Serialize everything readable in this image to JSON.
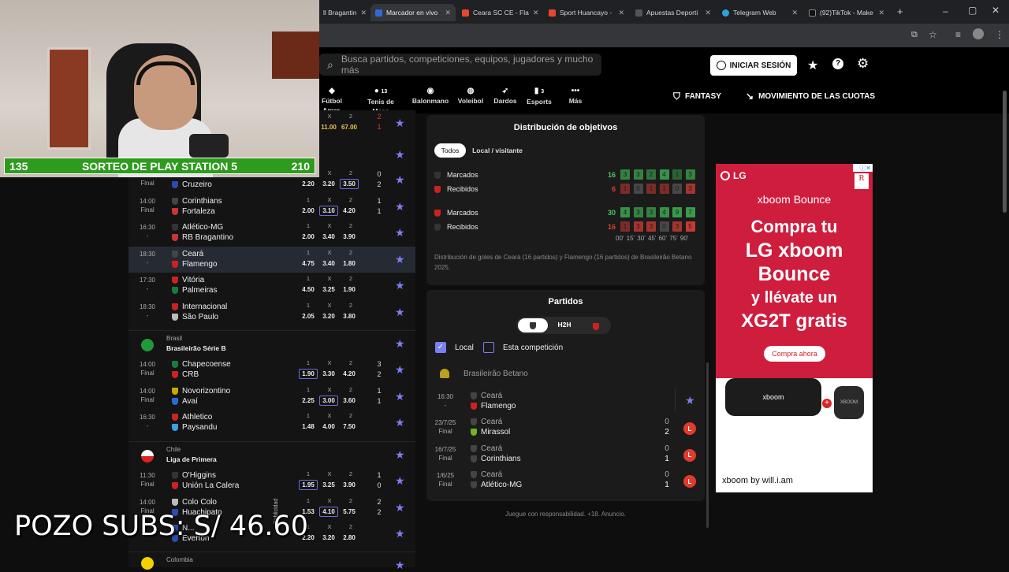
{
  "browser": {
    "tabs": [
      {
        "label": "ll Bragantin",
        "color": "#4a7bd4",
        "active": false
      },
      {
        "label": "Marcador en vivo",
        "color": "#2f6ad8",
        "active": true
      },
      {
        "label": "Ceara SC CE - Fla",
        "color": "#e8472f",
        "active": false
      },
      {
        "label": "Sport Huancayo -",
        "color": "#e8472f",
        "active": false
      },
      {
        "label": "Apuestas Deporti",
        "color": "#222",
        "active": false
      },
      {
        "label": "Telegram Web",
        "color": "#2aa3e0",
        "active": false
      },
      {
        "label": "(92)TikTok - Make",
        "color": "#111",
        "active": false
      }
    ]
  },
  "header": {
    "search_placeholder": "Busca partidos, competiciones, equipos, jugadores y mucho más",
    "login_label": "INICIAR SESIÓN"
  },
  "sports_nav": [
    {
      "label": "Fútbol Amer.",
      "count": ""
    },
    {
      "label": "Tenis de Mesa",
      "count": "13"
    },
    {
      "label": "Balonmano",
      "count": ""
    },
    {
      "label": "Voleibol",
      "count": ""
    },
    {
      "label": "Dardos",
      "count": ""
    },
    {
      "label": "Esports",
      "count": "3"
    },
    {
      "label": "Más",
      "count": ""
    }
  ],
  "top_buttons": {
    "fantasy": "FANTASY",
    "odds_movement": "MOVIMIENTO DE LAS CUOTAS"
  },
  "stream": {
    "sorteo_left": "135",
    "sorteo_title": "SORTEO DE PLAY STATION 5",
    "sorteo_right": "210",
    "pozo": "POZO SUBS: S/ 46.60",
    "publicidad": "Publicidad"
  },
  "odds_headers": {
    "one": "1",
    "x": "X",
    "two": "2"
  },
  "top_partial": {
    "odd_x": "11.00",
    "odd_2": "67.00",
    "s1": "2",
    "s2": "1"
  },
  "matches_a": [
    {
      "time": "",
      "status": "Final",
      "home": "",
      "away": "Cruzeiro",
      "o1": "2.20",
      "ox": "3.20",
      "o2": "3.50",
      "s1": "0",
      "s2": "2",
      "box": "o2",
      "hc": "#555",
      "ac": "#2b4bb0"
    },
    {
      "time": "14:00",
      "status": "Final",
      "home": "Corinthians",
      "away": "Fortaleza",
      "o1": "2.00",
      "ox": "3.10",
      "o2": "4.20",
      "s1": "1",
      "s2": "1",
      "box": "ox",
      "hc": "#444",
      "ac": "#c33"
    },
    {
      "time": "16:30",
      "status": "-",
      "home": "Atlético-MG",
      "away": "RB Bragantino",
      "o1": "2.00",
      "ox": "3.40",
      "o2": "3.90",
      "s1": "",
      "s2": "",
      "box": "",
      "hc": "#333",
      "ac": "#c33"
    },
    {
      "time": "18:30",
      "status": "-",
      "home": "Ceará",
      "away": "Flamengo",
      "o1": "4.75",
      "ox": "3.40",
      "o2": "1.80",
      "s1": "",
      "s2": "",
      "box": "",
      "hc": "#444",
      "ac": "#c22"
    },
    {
      "time": "17:30",
      "status": "-",
      "home": "Vitória",
      "away": "Palmeiras",
      "o1": "4.50",
      "ox": "3.25",
      "o2": "1.90",
      "s1": "",
      "s2": "",
      "box": "",
      "hc": "#c22",
      "ac": "#1a7a3a"
    },
    {
      "time": "18:30",
      "status": "-",
      "home": "Internacional",
      "away": "São Paulo",
      "o1": "2.05",
      "ox": "3.20",
      "o2": "3.80",
      "s1": "",
      "s2": "",
      "box": "",
      "hc": "#c22",
      "ac": "#bbb"
    }
  ],
  "league_b": {
    "country": "Brasil",
    "name": "Brasileirão Série B"
  },
  "matches_b": [
    {
      "time": "14:00",
      "status": "Final",
      "home": "Chapecoense",
      "away": "CRB",
      "o1": "1.90",
      "ox": "3.30",
      "o2": "4.20",
      "s1": "3",
      "s2": "2",
      "box": "o1",
      "hc": "#1a7a3a",
      "ac": "#c22"
    },
    {
      "time": "14:00",
      "status": "Final",
      "home": "Novorizontino",
      "away": "Avaí",
      "o1": "2.25",
      "ox": "3.00",
      "o2": "3.60",
      "s1": "1",
      "s2": "1",
      "box": "ox",
      "hc": "#c9a800",
      "ac": "#2b6bd0"
    },
    {
      "time": "16:30",
      "status": "-",
      "home": "Athletico",
      "away": "Paysandu",
      "o1": "1.48",
      "ox": "4.00",
      "o2": "7.50",
      "s1": "",
      "s2": "",
      "box": "",
      "hc": "#c22",
      "ac": "#3aa0e0"
    }
  ],
  "league_c": {
    "country": "Chile",
    "name": "Liga de Primera"
  },
  "matches_c": [
    {
      "time": "11:30",
      "status": "Final",
      "home": "O'Higgins",
      "away": "Unión La Calera",
      "o1": "1.95",
      "ox": "3.25",
      "o2": "3.90",
      "s1": "1",
      "s2": "0",
      "box": "o1",
      "hc": "#333",
      "ac": "#c22"
    },
    {
      "time": "14:00",
      "status": "Final",
      "home": "Colo Colo",
      "away": "Huachipato",
      "o1": "1.53",
      "ox": "4.10",
      "o2": "5.75",
      "s1": "2",
      "s2": "2",
      "box": "ox",
      "hc": "#bbb",
      "ac": "#2b4bb0"
    },
    {
      "time": "",
      "status": "",
      "home": "N...",
      "away": "Everton",
      "o1": "2.20",
      "ox": "3.20",
      "o2": "2.80",
      "s1": "",
      "s2": "",
      "box": "",
      "hc": "#2b4bb0",
      "ac": "#2b4bb0"
    }
  ],
  "league_d": {
    "country": "Colombia",
    "name": ""
  },
  "goals": {
    "title": "Distribución de objetivos",
    "tab_all": "Todos",
    "tab_homeaway": "Local / visitante",
    "ceara_scored_label": "Marcados",
    "ceara_scored_total": "16",
    "ceara_scored": [
      "3",
      "3",
      "2",
      "4",
      "1",
      "3"
    ],
    "ceara_conceded_label": "Recibidos",
    "ceara_conceded_total": "6",
    "ceara_conceded": [
      "1",
      "0",
      "1",
      "1",
      "0",
      "3"
    ],
    "fla_scored_label": "Marcados",
    "fla_scored_total": "30",
    "fla_scored": [
      "4",
      "3",
      "3",
      "4",
      "9",
      "7"
    ],
    "fla_conceded_label": "Recibidos",
    "fla_conceded_total": "16",
    "fla_conceded": [
      "1",
      "3",
      "3",
      "0",
      "3",
      "5"
    ],
    "minutes": "00' 15' 30' 45' 60' 75' 90'",
    "note": "Distribución de goles de Ceará (16 partidos) y Flamengo (16 partidos) de Brasileirão Betano 2025."
  },
  "partidos": {
    "title": "Partidos",
    "h2h": "H2H",
    "local_label": "Local",
    "competition_label": "Esta competición",
    "league": "Brasileirão Betano",
    "rows": [
      {
        "date": "16:30",
        "status": "-",
        "home": "Ceará",
        "away": "Flamengo",
        "s1": "",
        "s2": "",
        "badge": "",
        "ac": "#c22"
      },
      {
        "date": "23/7/25",
        "status": "Final",
        "home": "Ceará",
        "away": "Mirassol",
        "s1": "0",
        "s2": "2",
        "badge": "L",
        "ac": "#6ab820"
      },
      {
        "date": "16/7/25",
        "status": "Final",
        "home": "Ceará",
        "away": "Corinthians",
        "s1": "0",
        "s2": "1",
        "badge": "L",
        "ac": "#444"
      },
      {
        "date": "1/6/25",
        "status": "Final",
        "home": "Ceará",
        "away": "Atlético-MG",
        "s1": "0",
        "s2": "1",
        "badge": "L",
        "ac": "#444"
      }
    ],
    "footer": "Juegue con responsabilidad. +18. Anuncio."
  },
  "ad": {
    "brand": "LG",
    "product": "xboom Bounce",
    "line1": "Compra tu",
    "line2": "LG xboom",
    "line3": "Bounce",
    "line4": "y llévate un",
    "line5": "XG2T gratis",
    "cta": "Compra ahora",
    "speaker_brand": "xboom",
    "speaker_small": "XBOOM",
    "footer": "xboom by will.i.am"
  }
}
